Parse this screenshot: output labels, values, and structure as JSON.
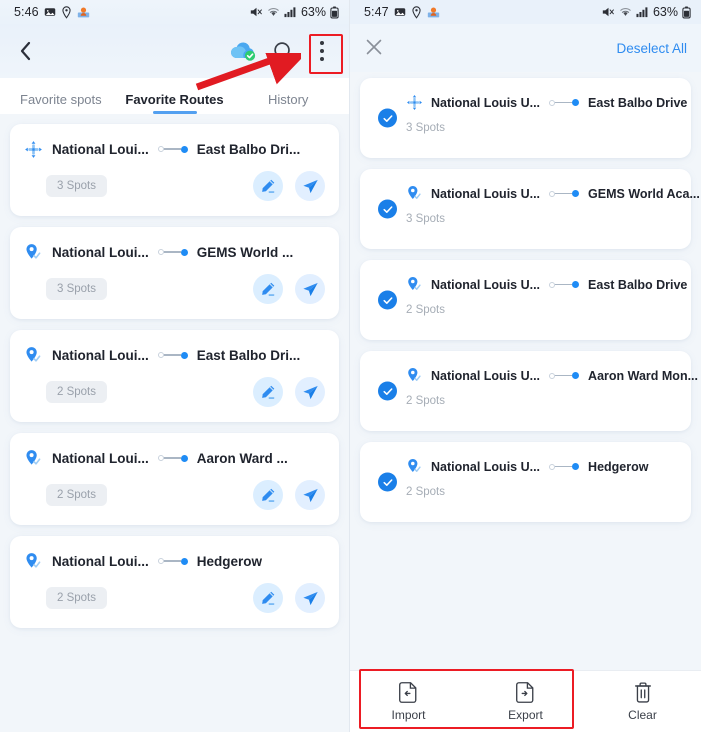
{
  "left": {
    "statusbar": {
      "time": "5:46",
      "battery": "63%",
      "icons": [
        "image-icon",
        "location-icon",
        "map-person-icon",
        "mute-icon",
        "wifi-icon",
        "signal-icon",
        "battery-icon"
      ]
    },
    "appbar": {
      "back_icon": "back-chevron-icon",
      "cloud_icon": "cloud-synced-icon",
      "search_icon": "search-icon",
      "menu_icon": "kebab-menu-icon"
    },
    "tabs": [
      {
        "label": "Favorite spots",
        "active": false
      },
      {
        "label": "Favorite Routes",
        "active": true
      },
      {
        "label": "History",
        "active": false
      }
    ],
    "cards": [
      {
        "start_icon": "move-arrows-icon",
        "start": "National Loui...",
        "dest": "East Balbo Dri...",
        "spots": "3 Spots",
        "edit_label": "edit-icon",
        "send_label": "send-icon"
      },
      {
        "start_icon": "map-pin-check-icon",
        "start": "National Loui...",
        "dest": "GEMS World ...",
        "spots": "3 Spots",
        "edit_label": "edit-icon",
        "send_label": "send-icon"
      },
      {
        "start_icon": "map-pin-check-icon",
        "start": "National Loui...",
        "dest": "East Balbo Dri...",
        "spots": "2 Spots",
        "edit_label": "edit-icon",
        "send_label": "send-icon"
      },
      {
        "start_icon": "map-pin-check-icon",
        "start": "National Loui...",
        "dest": "Aaron Ward ...",
        "spots": "2 Spots",
        "edit_label": "edit-icon",
        "send_label": "send-icon"
      },
      {
        "start_icon": "map-pin-check-icon",
        "start": "National Loui...",
        "dest": "Hedgerow",
        "spots": "2 Spots",
        "edit_label": "edit-icon",
        "send_label": "send-icon"
      }
    ]
  },
  "right": {
    "statusbar": {
      "time": "5:47",
      "battery": "63%"
    },
    "appbar": {
      "close_icon": "close-icon",
      "deselect_label": "Deselect All"
    },
    "cards": [
      {
        "start_icon": "move-arrows-icon",
        "start": "National Louis U...",
        "dest": "East Balbo Drive",
        "spots": "3 Spots",
        "checked": true
      },
      {
        "start_icon": "map-pin-check-icon",
        "start": "National Louis U...",
        "dest": "GEMS World Aca...",
        "spots": "3 Spots",
        "checked": true
      },
      {
        "start_icon": "map-pin-check-icon",
        "start": "National Louis U...",
        "dest": "East Balbo Drive",
        "spots": "2 Spots",
        "checked": true
      },
      {
        "start_icon": "map-pin-check-icon",
        "start": "National Louis U...",
        "dest": "Aaron Ward Mon...",
        "spots": "2 Spots",
        "checked": true
      },
      {
        "start_icon": "map-pin-check-icon",
        "start": "National Louis U...",
        "dest": "Hedgerow",
        "spots": "2 Spots",
        "checked": true
      }
    ],
    "bottombar": [
      {
        "label": "Import",
        "icon": "file-import-icon"
      },
      {
        "label": "Export",
        "icon": "file-export-icon"
      },
      {
        "label": "Clear",
        "icon": "trash-icon"
      }
    ]
  },
  "annotations": {
    "accent_red": "#ec1c24",
    "highlight_menu": "kebab-menu-highlight",
    "highlight_bottom": "import-export-highlight",
    "arrow": "red-arrow-pointing-to-menu"
  },
  "colors": {
    "accent_blue": "#1f8cf5",
    "tab_underline": "#53a0f0",
    "check_blue": "#1a7fe8",
    "bg": "#f2f6fa",
    "card": "#ffffff"
  }
}
